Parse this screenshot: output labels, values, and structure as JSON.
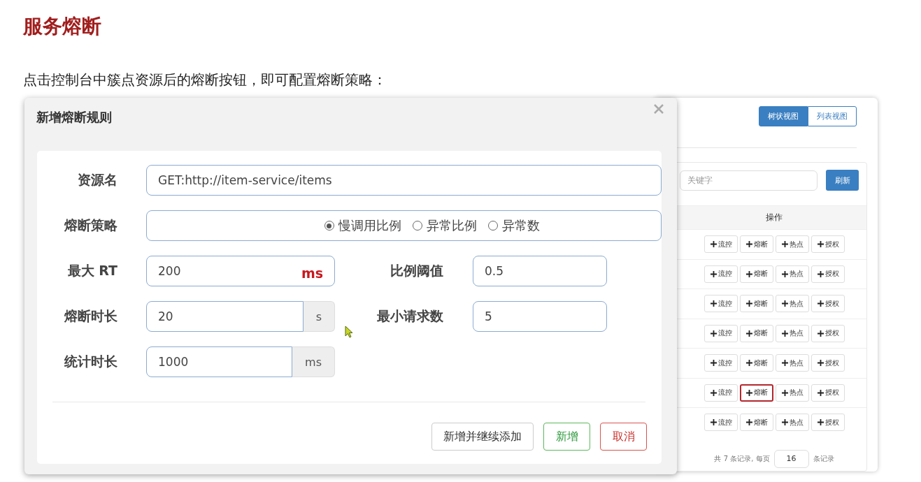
{
  "heading": "服务熔断",
  "intro": "点击控制台中簇点资源后的熔断按钮，即可配置熔断策略：",
  "console": {
    "view_toggle": [
      {
        "label": "树状视图",
        "selected": true
      },
      {
        "label": "列表视图",
        "selected": false
      }
    ],
    "search": {
      "placeholder": "关键字"
    },
    "refresh_button": "刷新",
    "table": {
      "columns": [
        "操作"
      ],
      "rows": [
        {
          "actions": [
            {
              "label": "流控",
              "highlighted": false
            },
            {
              "label": "熔断",
              "highlighted": false
            },
            {
              "label": "热点",
              "highlighted": false
            },
            {
              "label": "授权",
              "highlighted": false
            }
          ]
        },
        {
          "actions": [
            {
              "label": "流控",
              "highlighted": false
            },
            {
              "label": "熔断",
              "highlighted": false
            },
            {
              "label": "热点",
              "highlighted": false
            },
            {
              "label": "授权",
              "highlighted": false
            }
          ]
        },
        {
          "actions": [
            {
              "label": "流控",
              "highlighted": false
            },
            {
              "label": "熔断",
              "highlighted": false
            },
            {
              "label": "热点",
              "highlighted": false
            },
            {
              "label": "授权",
              "highlighted": false
            }
          ]
        },
        {
          "actions": [
            {
              "label": "流控",
              "highlighted": false
            },
            {
              "label": "熔断",
              "highlighted": false
            },
            {
              "label": "热点",
              "highlighted": false
            },
            {
              "label": "授权",
              "highlighted": false
            }
          ]
        },
        {
          "actions": [
            {
              "label": "流控",
              "highlighted": false
            },
            {
              "label": "熔断",
              "highlighted": false
            },
            {
              "label": "热点",
              "highlighted": false
            },
            {
              "label": "授权",
              "highlighted": false
            }
          ]
        },
        {
          "actions": [
            {
              "label": "流控",
              "highlighted": false
            },
            {
              "label": "熔断",
              "highlighted": true
            },
            {
              "label": "热点",
              "highlighted": false
            },
            {
              "label": "授权",
              "highlighted": false
            }
          ]
        },
        {
          "actions": [
            {
              "label": "流控",
              "highlighted": false
            },
            {
              "label": "熔断",
              "highlighted": false
            },
            {
              "label": "热点",
              "highlighted": false
            },
            {
              "label": "授权",
              "highlighted": false
            }
          ]
        }
      ]
    },
    "pagination": {
      "before": "共 7 条记录, 每页",
      "page_size": "16",
      "after": "条记录"
    }
  },
  "dialog": {
    "title": "新增熔断规则",
    "rows": [
      {
        "cells": [
          {
            "kind": "text",
            "label": "资源名",
            "value": "GET:http://item-service/items"
          }
        ]
      },
      {
        "cells": [
          {
            "kind": "radio",
            "label": "熔断策略",
            "options": [
              {
                "label": "慢调用比例",
                "selected": true
              },
              {
                "label": "异常比例",
                "selected": false
              },
              {
                "label": "异常数",
                "selected": false
              }
            ]
          }
        ]
      },
      {
        "cells": [
          {
            "kind": "suffix",
            "label": "最大 RT",
            "value": "200",
            "suffix": "ms"
          },
          {
            "kind": "text",
            "label": "比例阈值",
            "value": "0.5"
          }
        ]
      },
      {
        "cells": [
          {
            "kind": "addon",
            "label": "熔断时长",
            "value": "20",
            "addon": "s"
          },
          {
            "kind": "text",
            "label": "最小请求数",
            "value": "5"
          }
        ]
      },
      {
        "cells": [
          {
            "kind": "addon",
            "label": "统计时长",
            "value": "1000",
            "addon": "ms"
          }
        ]
      }
    ],
    "buttons": [
      {
        "label": "新增并继续添加",
        "kind": "default"
      },
      {
        "label": "新增",
        "kind": "success"
      },
      {
        "label": "取消",
        "kind": "danger"
      }
    ]
  }
}
